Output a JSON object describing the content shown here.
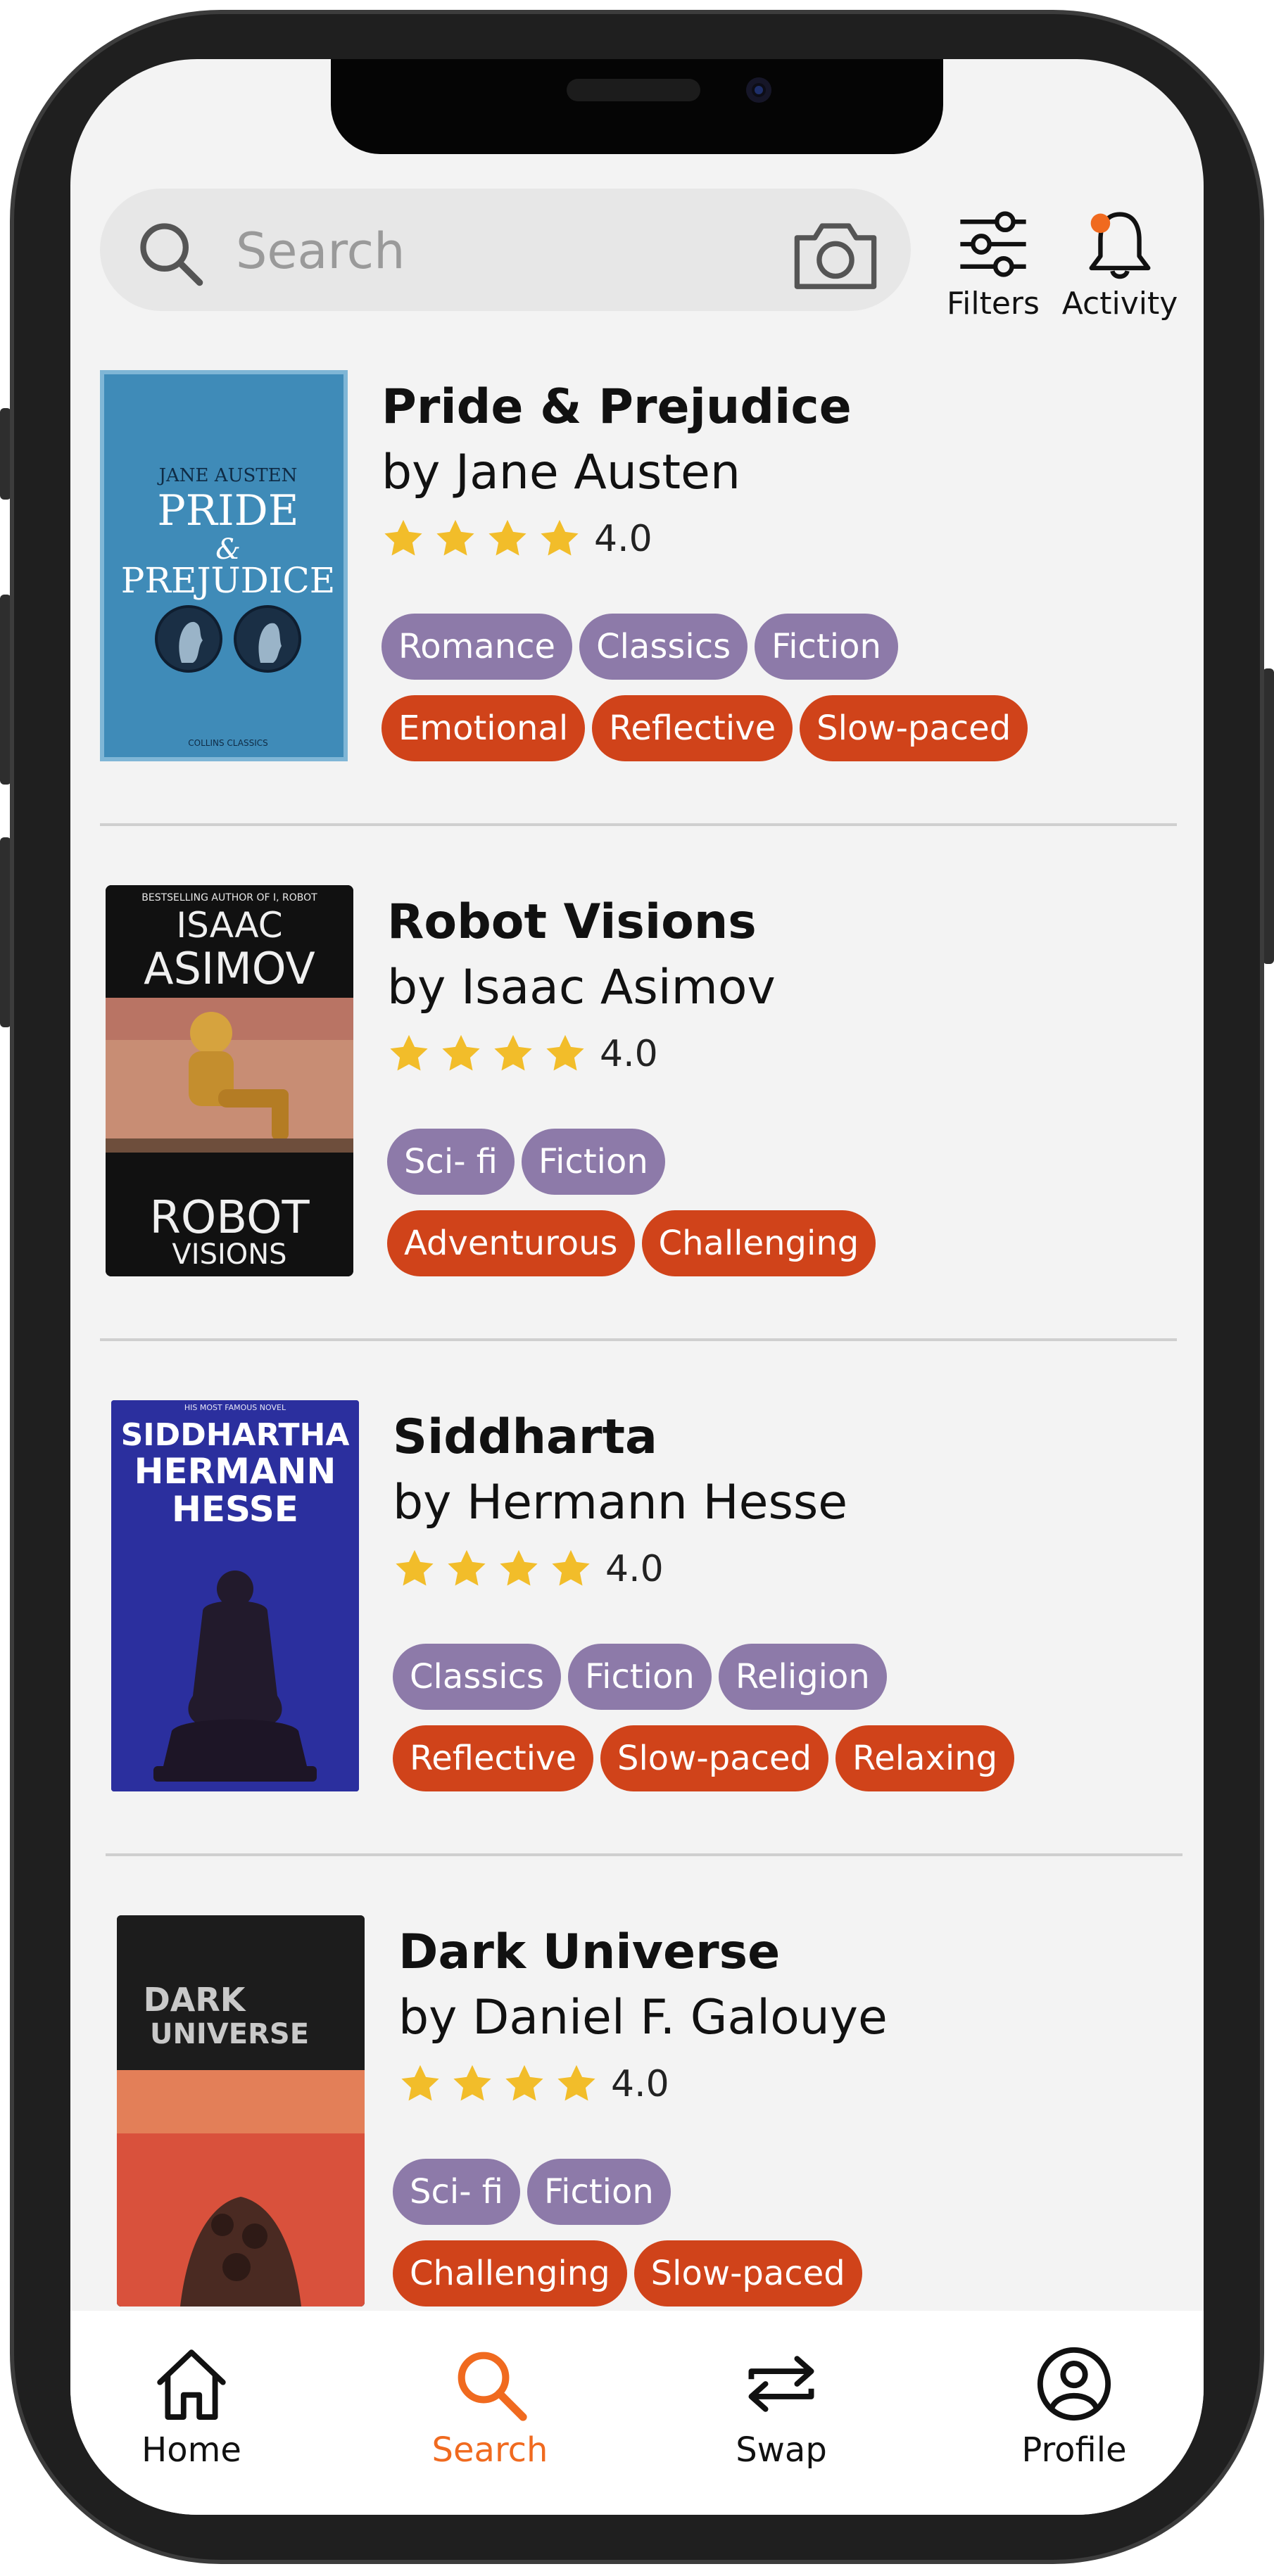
{
  "search": {
    "placeholder": "Search"
  },
  "toolbar": {
    "filters_label": "Filters",
    "activity_label": "Activity"
  },
  "colors": {
    "accent": "#f06a1f",
    "genre_tag": "#8d7aa9",
    "mood_tag": "#d0431a",
    "star": "#f2bd2a"
  },
  "books": [
    {
      "title": "Pride & Prejudice",
      "author": "by Jane Austen",
      "rating": "4.0",
      "stars": 4,
      "genres": [
        "Romance",
        "Classics",
        "Fiction"
      ],
      "moods": [
        "Emotional",
        "Reflective",
        "Slow-paced"
      ],
      "cover": {
        "line1": "JANE AUSTEN",
        "line2": "PRIDE",
        "line3": "&",
        "line4": "PREJUDICE",
        "footer": "COLLINS CLASSICS"
      }
    },
    {
      "title": "Robot Visions",
      "author": "by Isaac Asimov",
      "rating": "4.0",
      "stars": 4,
      "genres": [
        "Sci- fi",
        "Fiction"
      ],
      "moods": [
        "Adventurous",
        "Challenging"
      ],
      "cover": {
        "top": "BESTSELLING AUTHOR OF I, ROBOT",
        "line1": "ISAAC",
        "line2": "ASIMOV",
        "line3": "ROBOT",
        "line4": "VISIONS"
      }
    },
    {
      "title": "Siddharta",
      "author": "by Hermann Hesse",
      "rating": "4.0",
      "stars": 4,
      "genres": [
        "Classics",
        "Fiction",
        "Religion"
      ],
      "moods": [
        "Reflective",
        "Slow-paced",
        "Relaxing"
      ],
      "cover": {
        "top": "HIS MOST FAMOUS NOVEL",
        "line1": "SIDDHARTHA",
        "line2": "HERMANN",
        "line3": "HESSE"
      }
    },
    {
      "title": "Dark Universe",
      "author": "by Daniel F. Galouye",
      "rating": "4.0",
      "stars": 4,
      "genres": [
        "Sci- fi",
        "Fiction"
      ],
      "moods": [
        "Challenging",
        "Slow-paced"
      ],
      "cover": {
        "line1": "DARK",
        "line2": "UNIVERSE"
      }
    }
  ],
  "nav": {
    "home": "Home",
    "search": "Search",
    "swap": "Swap",
    "profile": "Profile"
  }
}
